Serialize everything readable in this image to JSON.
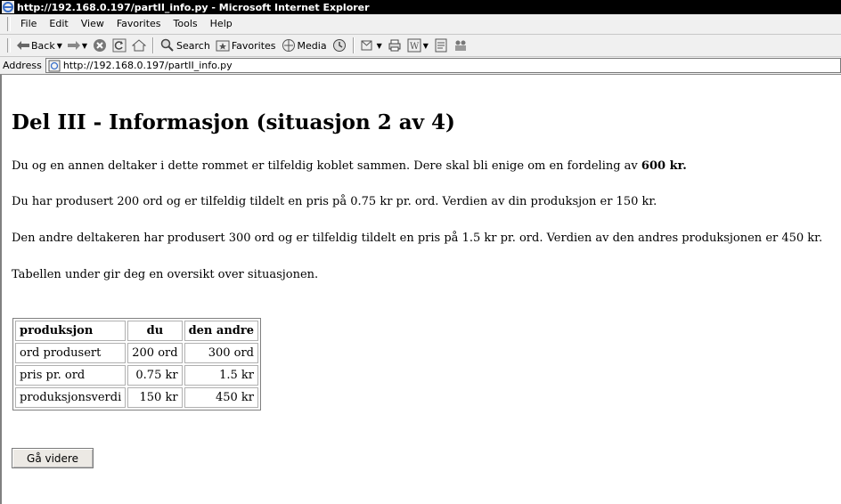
{
  "window": {
    "title": "http://192.168.0.197/partII_info.py - Microsoft Internet Explorer"
  },
  "menu": [
    "File",
    "Edit",
    "View",
    "Favorites",
    "Tools",
    "Help"
  ],
  "toolbar": {
    "back_label": "Back",
    "search_label": "Search",
    "favorites_label": "Favorites",
    "media_label": "Media"
  },
  "address": {
    "label": "Address",
    "url": "http://192.168.0.197/partII_info.py"
  },
  "page": {
    "heading": "Del III - Informasjon (situasjon 2 av 4)",
    "p1_text": "Du og en annen deltaker i dette rommet er tilfeldig koblet sammen. Dere skal bli enige om en fordeling av ",
    "p1_bold": "600 kr.",
    "p2": "Du har produsert 200 ord og er tilfeldig tildelt en pris på 0.75 kr pr. ord. Verdien av din produksjon er 150 kr.",
    "p3": "Den andre deltakeren har produsert 300 ord og er tilfeldig tildelt en pris på 1.5 kr pr. ord. Verdien av den andres produksjonen er 450 kr.",
    "p4": "Tabellen under gir deg en oversikt over situasjonen.",
    "table": {
      "headers": [
        "produksjon",
        "du",
        "den andre"
      ],
      "rows": [
        [
          "ord produsert",
          "200 ord",
          "300 ord"
        ],
        [
          "pris pr. ord",
          "0.75 kr",
          "1.5 kr"
        ],
        [
          "produksjonsverdi",
          "150 kr",
          "450 kr"
        ]
      ]
    },
    "continue_button": "Gå videre"
  }
}
